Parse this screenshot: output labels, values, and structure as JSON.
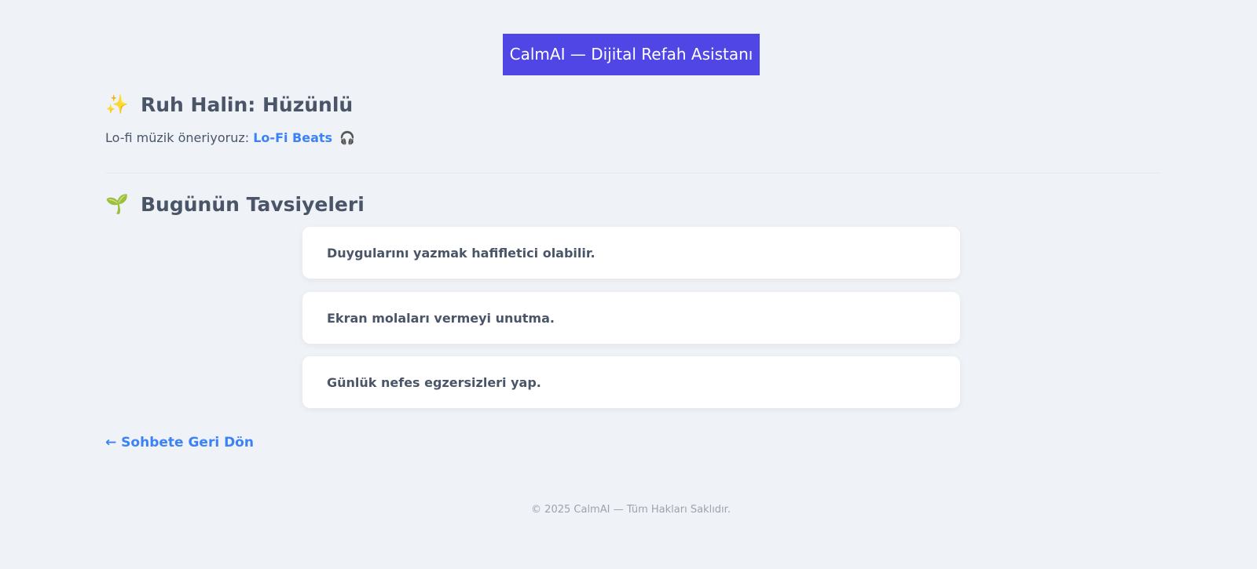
{
  "header": {
    "brand_label": "CalmAI — Dijital Refah Asistanı",
    "brand_color": "#4f46e5"
  },
  "mood": {
    "icon": "sparkles-icon",
    "icon_glyph": "✨",
    "title": "Ruh Halin: Hüzünlü",
    "music_prefix": "Lo-fi müzik öneriyoruz:",
    "music_link_label": "Lo-Fi Beats",
    "music_icon": "headphones-icon",
    "music_icon_glyph": "🎧"
  },
  "recommendations": {
    "icon": "seedling-icon",
    "icon_glyph": "🌱",
    "title": "Bugünün Tavsiyeleri",
    "items": [
      "Duygularını yazmak hafifletici olabilir.",
      "Ekran molaları vermeyi unutma.",
      "Günlük nefes egzersizleri yap."
    ]
  },
  "navigation": {
    "back_label": "← Sohbete Geri Dön"
  },
  "footer": {
    "copyright": "© 2025 CalmAI — Tüm Hakları Saklıdır."
  },
  "colors": {
    "background": "#eff2f7",
    "link": "#3b82f6",
    "text": "#4a5568",
    "muted": "#9ca3af"
  }
}
